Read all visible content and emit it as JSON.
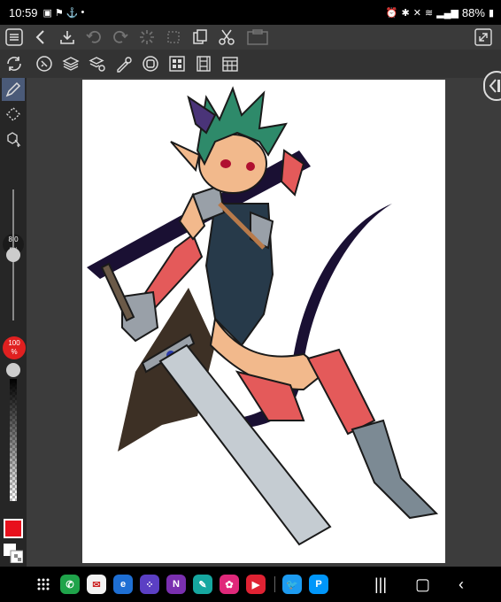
{
  "status_bar": {
    "time": "10:59",
    "battery": "88%",
    "notification_icons": [
      "gallery-icon",
      "flag-icon",
      "anchor-icon",
      "dot-icon"
    ],
    "system_icons": [
      "alarm-icon",
      "bluetooth-icon",
      "mute-icon",
      "wifi-icon",
      "signal-icon"
    ]
  },
  "toolbar": {
    "top_icons": [
      "menu-icon",
      "back-icon",
      "save-icon",
      "undo-icon",
      "redo-icon",
      "spinner-icon",
      "transform-icon",
      "copy-icon",
      "cut-icon",
      "paste-icon"
    ],
    "second_icons": [
      "eraser-icon",
      "layers-icon",
      "layer-settings-icon",
      "brush-settings-icon",
      "record-icon",
      "grid-icon",
      "film-icon",
      "calendar-icon"
    ]
  },
  "left_tools": {
    "brush_size": "8.0",
    "brush_unit": "px",
    "opacity_value": "100",
    "opacity_unit": "%",
    "brush_size_level": 0.5,
    "opacity_level": 1.0,
    "main_color": "#e8101c",
    "sub_color": "#ffffff"
  },
  "nav_bar": {
    "apps": [
      "app-drawer-icon",
      "phone-icon",
      "mail-icon",
      "edge-icon",
      "apps-icon",
      "onenote-icon",
      "sketch-icon",
      "flower-icon",
      "youtube-icon",
      "twitter-icon",
      "pixiv-icon"
    ],
    "pixiv_glyph": "P"
  }
}
